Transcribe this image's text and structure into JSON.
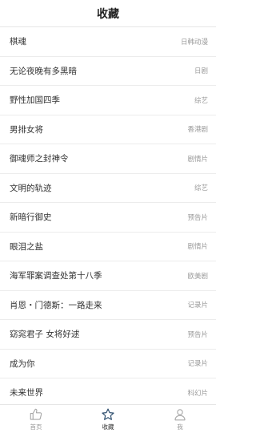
{
  "header": {
    "title": "收藏"
  },
  "favorites": [
    {
      "title": "棋魂",
      "category": "日韩动漫"
    },
    {
      "title": "无论夜晚有多黑暗",
      "category": "日剧"
    },
    {
      "title": "野性加国四季",
      "category": "综艺"
    },
    {
      "title": "男排女将",
      "category": "香港剧"
    },
    {
      "title": "御魂师之封神令",
      "category": "剧情片"
    },
    {
      "title": "文明的轨迹",
      "category": "综艺"
    },
    {
      "title": "新暗行御史",
      "category": "预告片"
    },
    {
      "title": "眼泪之盐",
      "category": "剧情片"
    },
    {
      "title": "海军罪案调查处第十八季",
      "category": "欧美剧"
    },
    {
      "title": "肖恩・门德斯：一路走来",
      "category": "记录片"
    },
    {
      "title": "窈窕君子 女将好逑",
      "category": "预告片"
    },
    {
      "title": "成为你",
      "category": "记录片"
    },
    {
      "title": "未来世界",
      "category": "科幻片"
    }
  ],
  "tabbar": {
    "items": [
      {
        "label": "首页",
        "icon": "thumbs-up-icon",
        "active": false
      },
      {
        "label": "收藏",
        "icon": "star-icon",
        "active": true
      },
      {
        "label": "我",
        "icon": "person-icon",
        "active": false
      }
    ]
  },
  "colors": {
    "active_icon": "#2f4f6f",
    "inactive_icon": "#a8a8a8",
    "divider": "#ececec"
  }
}
